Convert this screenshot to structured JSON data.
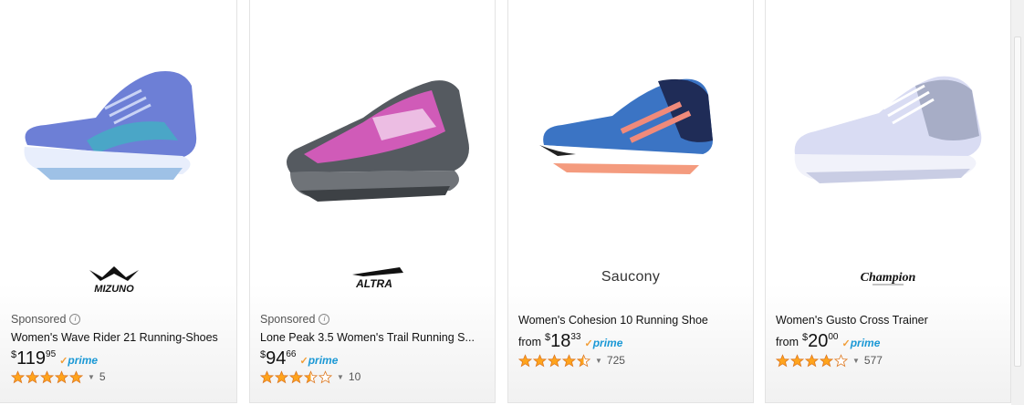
{
  "cards": [
    {
      "brand": "MIZUNO",
      "sponsored": "Sponsored",
      "title": "Women's Wave Rider 21 Running-Shoes",
      "price_prefix": "",
      "currency": "$",
      "price_whole": "119",
      "price_fraction": "95",
      "prime_label": "prime",
      "rating": 5,
      "review_count": "5",
      "shoe_colors": {
        "upper": "#6d7fd6",
        "accent": "#4aa6c7",
        "sole": "#e8eefc",
        "outsole": "#9ec1e6"
      }
    },
    {
      "brand": "ALTRA",
      "sponsored": "Sponsored",
      "title": "Lone Peak 3.5 Women's Trail Running S...",
      "price_prefix": "",
      "currency": "$",
      "price_whole": "94",
      "price_fraction": "66",
      "prime_label": "prime",
      "rating": 3.5,
      "review_count": "10",
      "shoe_colors": {
        "upper": "#d05bb8",
        "accent": "#555a60",
        "sole": "#6f7378",
        "outsole": "#3d4145"
      }
    },
    {
      "brand": "Saucony",
      "sponsored": "",
      "title": "Women's Cohesion 10 Running Shoe",
      "price_prefix": "from",
      "currency": "$",
      "price_whole": "18",
      "price_fraction": "33",
      "prime_label": "prime",
      "rating": 4.5,
      "review_count": "725",
      "shoe_colors": {
        "upper": "#3b74c4",
        "accent": "#f08a7a",
        "sole": "#ffffff",
        "outsole": "#f49b7e"
      }
    },
    {
      "brand": "Champion",
      "sponsored": "",
      "title": "Women's Gusto Cross Trainer",
      "price_prefix": "from",
      "currency": "$",
      "price_whole": "20",
      "price_fraction": "00",
      "prime_label": "prime",
      "rating": 4,
      "review_count": "577",
      "shoe_colors": {
        "upper": "#d9dcf3",
        "accent": "#a7adc6",
        "sole": "#f1f2fa",
        "outsole": "#c9cde4"
      }
    }
  ],
  "colors": {
    "star": "#ffa41c",
    "star_outline": "#de7921",
    "prime_check": "#f19e38",
    "prime_text": "#1a98d5"
  }
}
